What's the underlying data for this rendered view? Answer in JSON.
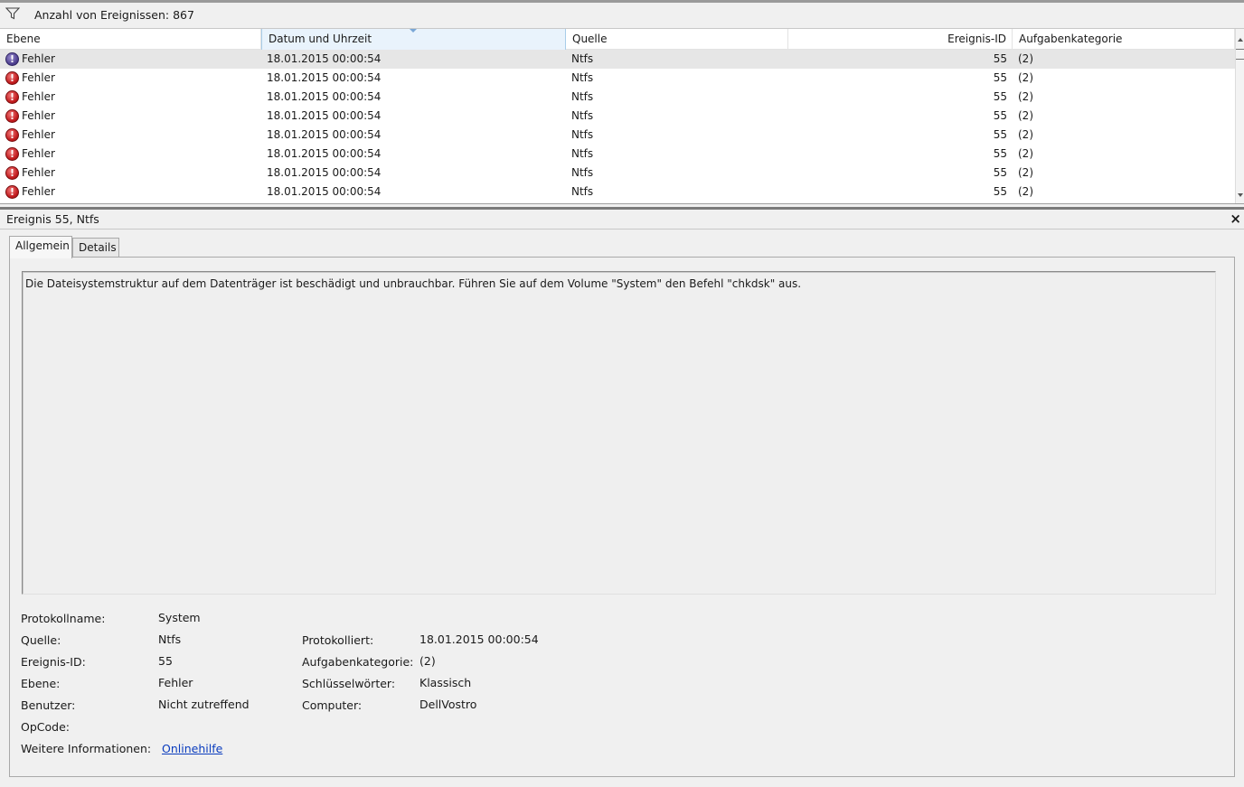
{
  "filter": {
    "icon": "filter-icon",
    "text": "Anzahl von Ereignissen: 867"
  },
  "grid": {
    "columns": [
      "Ebene",
      "Datum und Uhrzeit",
      "Quelle",
      "Ereignis-ID",
      "Aufgabenkategorie"
    ],
    "rows": [
      {
        "level": "Fehler",
        "datetime": "18.01.2015 00:00:54",
        "source": "Ntfs",
        "id": "55",
        "category": "(2)"
      },
      {
        "level": "Fehler",
        "datetime": "18.01.2015 00:00:54",
        "source": "Ntfs",
        "id": "55",
        "category": "(2)"
      },
      {
        "level": "Fehler",
        "datetime": "18.01.2015 00:00:54",
        "source": "Ntfs",
        "id": "55",
        "category": "(2)"
      },
      {
        "level": "Fehler",
        "datetime": "18.01.2015 00:00:54",
        "source": "Ntfs",
        "id": "55",
        "category": "(2)"
      },
      {
        "level": "Fehler",
        "datetime": "18.01.2015 00:00:54",
        "source": "Ntfs",
        "id": "55",
        "category": "(2)"
      },
      {
        "level": "Fehler",
        "datetime": "18.01.2015 00:00:54",
        "source": "Ntfs",
        "id": "55",
        "category": "(2)"
      },
      {
        "level": "Fehler",
        "datetime": "18.01.2015 00:00:54",
        "source": "Ntfs",
        "id": "55",
        "category": "(2)"
      },
      {
        "level": "Fehler",
        "datetime": "18.01.2015 00:00:54",
        "source": "Ntfs",
        "id": "55",
        "category": "(2)"
      }
    ]
  },
  "detail": {
    "title": "Ereignis 55, Ntfs",
    "close": "×",
    "tabs": [
      "Allgemein",
      "Details"
    ],
    "description": "Die Dateisystemstruktur auf dem Datenträger ist beschädigt und unbrauchbar. Führen Sie auf dem Volume \"System\" den Befehl \"chkdsk\" aus.",
    "props": {
      "protokollname_label": "Protokollname:",
      "protokollname": "System",
      "quelle_label": "Quelle:",
      "quelle": "Ntfs",
      "protokolliert_label": "Protokolliert:",
      "protokolliert": "18.01.2015 00:00:54",
      "ereignis_id_label": "Ereignis-ID:",
      "ereignis_id": "55",
      "aufgabenkategorie_label": "Aufgabenkategorie:",
      "aufgabenkategorie": "(2)",
      "ebene_label": "Ebene:",
      "ebene": "Fehler",
      "schluesselwoerter_label": "Schlüsselwörter:",
      "schluesselwoerter": "Klassisch",
      "benutzer_label": "Benutzer:",
      "benutzer": "Nicht zutreffend",
      "computer_label": "Computer:",
      "computer": "DellVostro",
      "opcode_label": "OpCode:",
      "opcode": "",
      "weitere_label": "Weitere Informationen:",
      "weitere_link": "Onlinehilfe"
    }
  }
}
